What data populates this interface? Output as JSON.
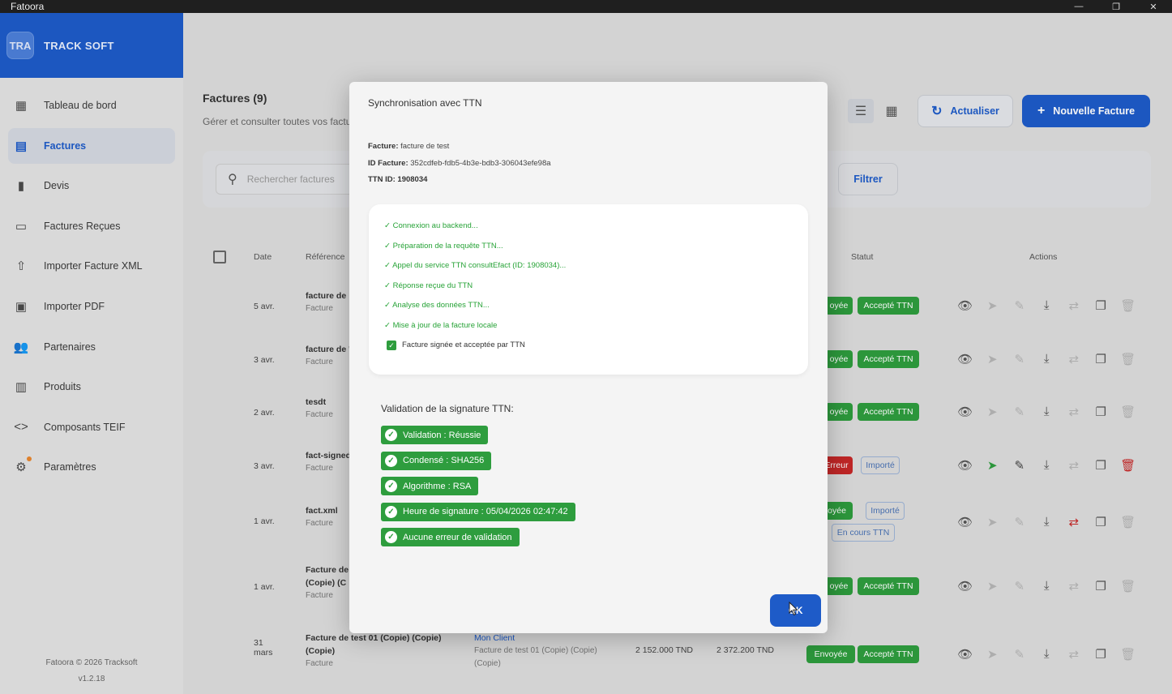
{
  "window": {
    "title": "Fatoora",
    "controls": [
      "—",
      "❐",
      "✕"
    ]
  },
  "brand": {
    "logo": "TRA",
    "name": "TRACK SOFT"
  },
  "sidebar": {
    "items": [
      {
        "label": "Tableau de bord",
        "icon": "dashboard-icon",
        "glyph": "▦"
      },
      {
        "label": "Factures",
        "icon": "invoice-icon",
        "glyph": "▤",
        "active": true
      },
      {
        "label": "Devis",
        "icon": "quote-icon",
        "glyph": "▮"
      },
      {
        "label": "Factures Reçues",
        "icon": "inbox-icon",
        "glyph": "▭"
      },
      {
        "label": "Importer Facture XML",
        "icon": "upload-icon",
        "glyph": "⇧"
      },
      {
        "label": "Importer PDF",
        "icon": "pdf-icon",
        "glyph": "▣"
      },
      {
        "label": "Partenaires",
        "icon": "people-icon",
        "glyph": "👥"
      },
      {
        "label": "Produits",
        "icon": "box-icon",
        "glyph": "▥"
      },
      {
        "label": "Composants TEIF",
        "icon": "code-icon",
        "glyph": "<>"
      },
      {
        "label": "Paramètres",
        "icon": "gear-icon",
        "glyph": "⚙"
      }
    ],
    "footer_line1": "Fatoora © 2026 Tracksoft",
    "footer_line2": "v1.2.18"
  },
  "main": {
    "title": "Factures (9)",
    "subtitle": "Gérer et consulter toutes vos factu",
    "refresh_label": "Actualiser",
    "new_label": "Nouvelle Facture",
    "search_placeholder": "Rechercher factures",
    "filter_label": "Filtrer",
    "columns": {
      "date": "Date",
      "reference": "Référence",
      "statut": "Statut",
      "actions": "Actions"
    }
  },
  "rows": [
    {
      "date": "5 avr.",
      "ref": "facture de",
      "type": "Facture",
      "b1": "oyée",
      "b2": "Accepté TTN"
    },
    {
      "date": "3 avr.",
      "ref": "facture de '",
      "type": "Facture",
      "b1": "oyée",
      "b2": "Accepté TTN"
    },
    {
      "date": "2 avr.",
      "ref": "tesdt",
      "type": "Facture",
      "b1": "oyée",
      "b2": "Accepté TTN"
    },
    {
      "date": "3 avr.",
      "ref": "fact-signed",
      "type": "Facture",
      "b1": "Erreur",
      "b2": "Importé"
    },
    {
      "date": "1 avr.",
      "ref": "fact.xml",
      "type": "Facture",
      "b1": "nvoyée",
      "b2": "Importé",
      "b3": "En cours TTN"
    },
    {
      "date": "1 avr.",
      "ref": "Facture de",
      "ref2": "(Copie) (C",
      "type": "Facture",
      "b1": "oyée",
      "b2": "Accepté TTN"
    },
    {
      "date": "31",
      "date2": "mars",
      "ref": "Facture de test 01 (Copie) (Copie)",
      "ref2": "(Copie)",
      "type": "Facture",
      "client": "Mon Client",
      "client_desc": "Facture de test 01 (Copie) (Copie)",
      "client_desc2": "(Copie)",
      "ht": "2 152.000 TND",
      "ttc": "2 372.200 TND",
      "b1": "Envoyée",
      "b2": "Accepté TTN"
    }
  ],
  "modal": {
    "title": "Synchronisation avec TTN",
    "facture_label": "Facture:",
    "facture_value": "facture de test",
    "id_label": "ID Facture:",
    "id_value": "352cdfeb-fdb5-4b3e-bdb3-306043efe98a",
    "ttn_label": "TTN ID:",
    "ttn_value": "1908034",
    "steps": [
      "✓ Connexion au backend...",
      "✓ Préparation de la requête TTN...",
      "✓ Appel du service TTN consultEfact (ID: 1908034)...",
      "✓ Réponse reçue du TTN",
      "✓ Analyse des données TTN...",
      "✓ Mise à jour de la facture locale"
    ],
    "final_step": "Facture signée et acceptée par TTN",
    "validation_title": "Validation de la signature TTN:",
    "validations": [
      "Validation : Réussie",
      "Condensé : SHA256",
      "Algorithme : RSA",
      "Heure de signature : 05/04/2026 02:47:42",
      "Aucune erreur de validation"
    ],
    "ok_label": "OK"
  },
  "colors": {
    "primary": "#1e5bc8",
    "success": "#2e9d3e",
    "danger": "#c62828"
  }
}
